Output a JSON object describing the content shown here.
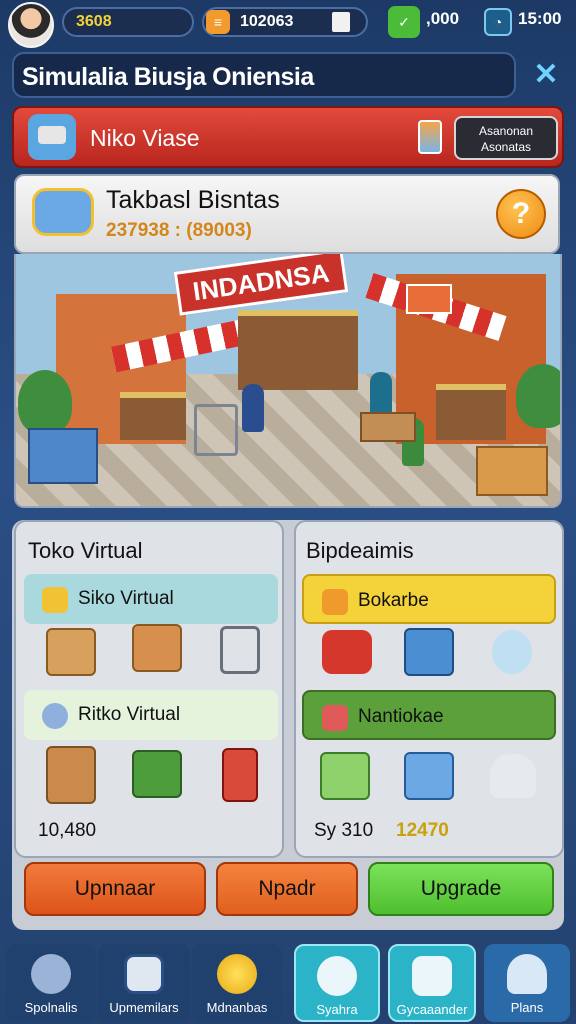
{
  "topbar": {
    "level_value": "3608",
    "coins_value": "102063",
    "cash_value": ",000",
    "time_value": "15:00",
    "avatar_icon": "avatar-icon",
    "coin_icon": "coin-stack-icon",
    "gift_icon": "gift-box-icon",
    "cash_icon": "cash-note-icon",
    "clock_icon": "clock-icon"
  },
  "title_bar": {
    "title": "Simulalia Biusja Oniensia",
    "close_label": "✕"
  },
  "banner": {
    "name": "Niko Viase",
    "button_label_line1": "Asanonan",
    "button_label_line2": "Asonatas"
  },
  "info_card": {
    "name": "Takbasl Bisntas",
    "value": "237938 : (89003)",
    "help_label": "?"
  },
  "scene": {
    "store_sign": "INDADNSA",
    "side_sign": ""
  },
  "left_panel": {
    "title": "Toko Virtual",
    "section1_label": "Siko Virtual",
    "section2_label": "Ritko Virtual",
    "value": "10,480"
  },
  "right_panel": {
    "title": "Bipdeaimis",
    "section1_label": "Bokarbe",
    "section2_label": "Nantiokae",
    "value_a": "Sy 310",
    "value_b": "12470"
  },
  "buttons": {
    "left_label": "Upnnaar",
    "middle_label": "Npadr",
    "right_label": "Upgrade"
  },
  "nav": {
    "items": [
      {
        "label": "Spolnalis",
        "icon": "gear-icon"
      },
      {
        "label": "Upmemilars",
        "icon": "shield-icon"
      },
      {
        "label": "Mdnanbas",
        "icon": "coin-icon"
      },
      {
        "label": "Syahra",
        "icon": "gear-icon"
      },
      {
        "label": "Gycaaander",
        "icon": "laptop-icon"
      },
      {
        "label": "Plans",
        "icon": "person-icon"
      }
    ]
  },
  "colors": {
    "banner_red": "#c9322b",
    "accent_orange": "#ee8a12",
    "green": "#5bbf3a",
    "yellow": "#f3d23a",
    "teal_nav": "#2bb3c8",
    "navy_bg": "#1d3a66"
  }
}
